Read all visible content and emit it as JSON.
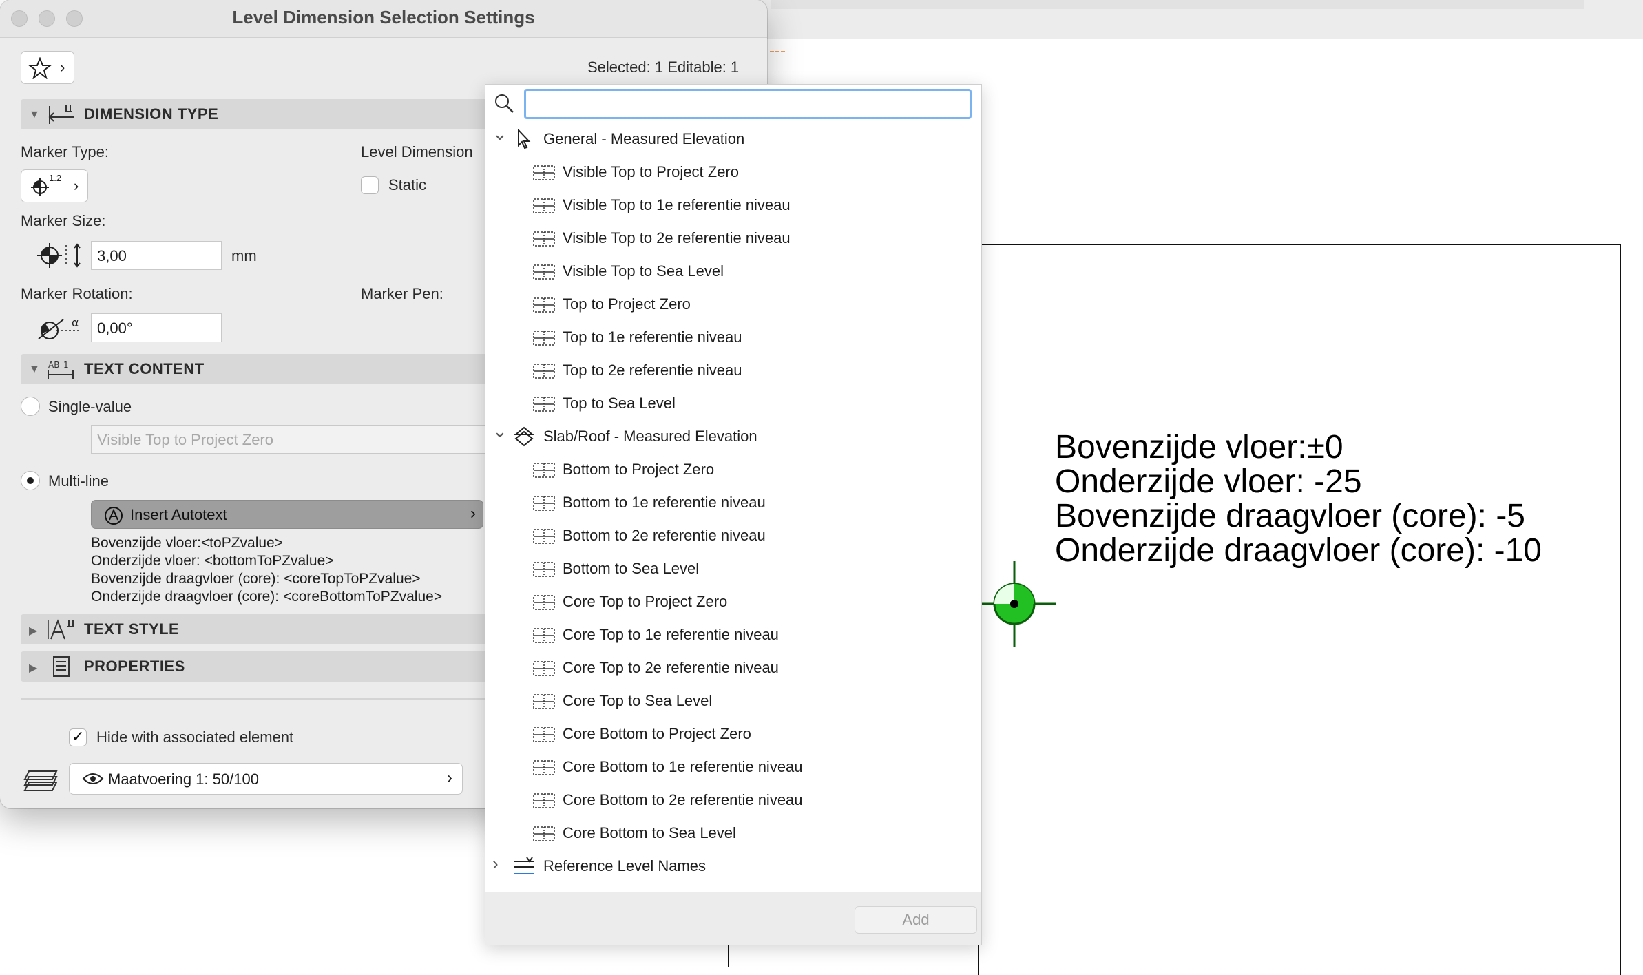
{
  "window": {
    "title": "Level Dimension Selection Settings"
  },
  "header": {
    "selection_status": "Selected: 1 Editable: 1"
  },
  "dimension_type": {
    "section_title": "DIMENSION TYPE",
    "marker_type_label": "Marker Type:",
    "marker_type_icon_text": "1.2",
    "level_dimension_label": "Level Dimension",
    "static_label": "Static",
    "static_checked": false,
    "marker_size_label": "Marker Size:",
    "marker_size_value": "3,00",
    "marker_size_unit": "mm",
    "marker_rotation_label": "Marker Rotation:",
    "marker_rotation_value": "0,00°",
    "marker_pen_label": "Marker Pen:"
  },
  "text_content": {
    "section_title": "TEXT CONTENT",
    "single_value_label": "Single-value",
    "single_value_field": "Visible Top to Project Zero",
    "multi_line_label": "Multi-line",
    "selected_mode": "Multi-line",
    "insert_autotext_label": "Insert Autotext",
    "lines": [
      "Bovenzijde vloer:<toPZvalue>",
      "Onderzijde vloer: <bottomToPZvalue>",
      "Bovenzijde draagvloer (core): <coreTopToPZvalue>",
      "Onderzijde draagvloer (core): <coreBottomToPZvalue>"
    ]
  },
  "text_style": {
    "section_title": "TEXT STYLE"
  },
  "properties": {
    "section_title": "PROPERTIES"
  },
  "footer": {
    "hide_with_element_label": "Hide with associated element",
    "hide_with_element_checked": true,
    "layer_value": "Maatvoering 1: 50/100"
  },
  "autotext_popup": {
    "search_placeholder": "",
    "add_button_label": "Add",
    "groups": [
      {
        "name": "General - Measured Elevation",
        "expanded": true,
        "icon": "cursor-icon",
        "items": [
          "Visible Top to Project Zero",
          "Visible Top to 1e referentie niveau",
          "Visible Top to 2e referentie niveau",
          "Visible Top to Sea Level",
          "Top to Project Zero",
          "Top to 1e referentie niveau",
          "Top to 2e referentie niveau",
          "Top to Sea Level"
        ]
      },
      {
        "name": "Slab/Roof - Measured Elevation",
        "expanded": true,
        "icon": "slab-icon",
        "items": [
          "Bottom to Project Zero",
          "Bottom to 1e referentie niveau",
          "Bottom to 2e referentie niveau",
          "Bottom to Sea Level",
          "Core Top to Project Zero",
          "Core Top to 1e referentie niveau",
          "Core Top to 2e referentie niveau",
          "Core Top to Sea Level",
          "Core Bottom to Project Zero",
          "Core Bottom to 1e referentie niveau",
          "Core Bottom to 2e referentie niveau",
          "Core Bottom to Sea Level"
        ]
      },
      {
        "name": "Reference Level Names",
        "expanded": false,
        "icon": "reference-levels-icon",
        "items": []
      }
    ]
  },
  "drawing": {
    "lines": [
      "Bovenzijde vloer:±0",
      "Onderzijde vloer: -25",
      "Bovenzijde draagvloer (core): -5",
      "Onderzijde draagvloer (core): -10"
    ],
    "marker_color": "#22c022"
  },
  "colors": {
    "dialog_bg": "#ececec",
    "section_bg": "#d8d8d8",
    "insert_autotext_bg": "#9e9e9e",
    "search_focus": "#7ab3f0"
  }
}
